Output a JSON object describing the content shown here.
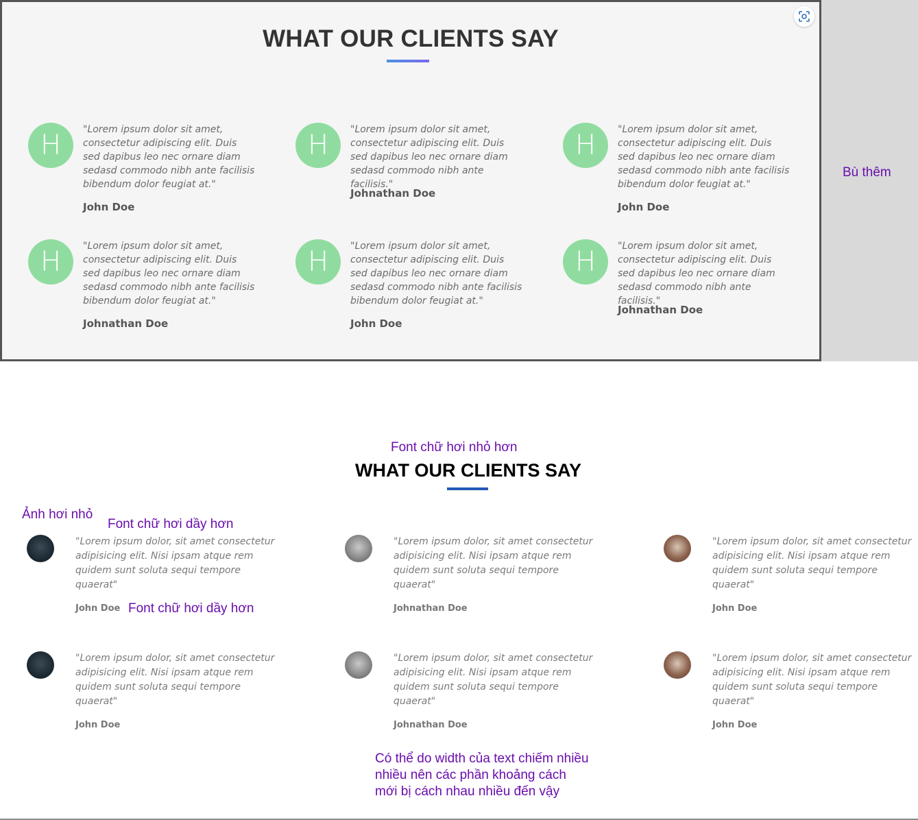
{
  "top": {
    "title": "WHAT OUR CLIENTS SAY",
    "avatar_letter": "H",
    "testimonials": [
      {
        "quote": "\"Lorem ipsum dolor sit amet, consectetur adipiscing elit. Duis sed dapibus leo nec ornare diam sedasd commodo nibh ante facilisis bibendum dolor feugiat at.\"",
        "name": "John Doe"
      },
      {
        "quote": "\"Lorem ipsum dolor sit amet, consectetur adipiscing elit. Duis sed dapibus leo nec ornare diam sedasd commodo nibh ante facilisis.\"",
        "name": "Johnathan Doe"
      },
      {
        "quote": "\"Lorem ipsum dolor sit amet, consectetur adipiscing elit. Duis sed dapibus leo nec ornare diam sedasd commodo nibh ante facilisis bibendum dolor feugiat at.\"",
        "name": "John Doe"
      },
      {
        "quote": "\"Lorem ipsum dolor sit amet, consectetur adipiscing elit. Duis sed dapibus leo nec ornare diam sedasd commodo nibh ante facilisis bibendum dolor feugiat at.\"",
        "name": "Johnathan Doe"
      },
      {
        "quote": "\"Lorem ipsum dolor sit amet, consectetur adipiscing elit. Duis sed dapibus leo nec ornare diam sedasd commodo nibh ante facilisis bibendum dolor feugiat at.\"",
        "name": "John Doe"
      },
      {
        "quote": "\"Lorem ipsum dolor sit amet, consectetur adipiscing elit. Duis sed dapibus leo nec ornare diam sedasd commodo nibh ante facilisis.\"",
        "name": "Johnathan Doe"
      }
    ]
  },
  "side_note": "Bù thêm",
  "notes": {
    "font_smaller": "Font chữ hơi nhỏ hơn",
    "image_smaller": "Ảnh hơi nhỏ",
    "font_bolder_1": "Font chữ hơi dầy hơn",
    "font_bolder_2": "Font chữ hơi dầy hơn",
    "spacing_1": "Có thể do width của text chiếm nhiều",
    "spacing_2": "nhiều nên các phần khoảng cách",
    "spacing_3": "mới bị cách nhau nhiều đến vậy"
  },
  "bottom": {
    "title": "WHAT OUR CLIENTS SAY",
    "testimonials": [
      {
        "quote": "\"Lorem ipsum dolor, sit amet consectetur adipisicing elit. Nisi ipsam atque rem quidem sunt soluta sequi tempore quaerat\"",
        "name": "John Doe",
        "avatar": "dark-building-photo"
      },
      {
        "quote": "\"Lorem ipsum dolor, sit amet consectetur adipisicing elit. Nisi ipsam atque rem quidem sunt soluta sequi tempore quaerat\"",
        "name": "Johnathan Doe",
        "avatar": "street-photo"
      },
      {
        "quote": "\"Lorem ipsum dolor, sit amet consectetur adipisicing elit. Nisi ipsam atque rem quidem sunt soluta sequi tempore quaerat\"",
        "name": "John Doe",
        "avatar": "brick-wall-photo"
      },
      {
        "quote": "\"Lorem ipsum dolor, sit amet consectetur adipisicing elit. Nisi ipsam atque rem quidem sunt soluta sequi tempore quaerat\"",
        "name": "John Doe",
        "avatar": "dark-building-photo"
      },
      {
        "quote": "\"Lorem ipsum dolor, sit amet consectetur adipisicing elit. Nisi ipsam atque rem quidem sunt soluta sequi tempore quaerat\"",
        "name": "Johnathan Doe",
        "avatar": "street-photo"
      },
      {
        "quote": "\"Lorem ipsum dolor, sit amet consectetur adipisicing elit. Nisi ipsam atque rem quidem sunt soluta sequi tempore quaerat\"",
        "name": "John Doe",
        "avatar": "brick-wall-photo"
      }
    ]
  },
  "colors": {
    "avatar_green": "#90dca0",
    "note_purple": "#6a0dad",
    "underline_blue": "#2458b8"
  }
}
